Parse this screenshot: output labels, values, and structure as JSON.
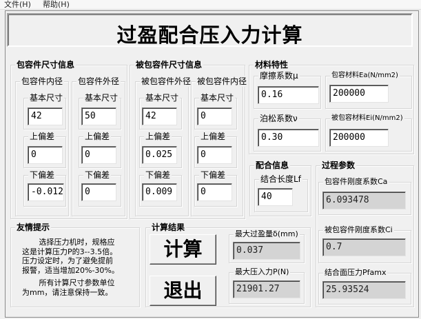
{
  "menu": {
    "file": "文件(H)",
    "help": "帮助(H)"
  },
  "title": "过盈配合压入力计算",
  "container": {
    "label": "包容件尺寸信息",
    "inner": {
      "label": "包容件内径",
      "basic": {
        "label": "基本尺寸",
        "value": "42"
      },
      "upper": {
        "label": "上偏差",
        "value": "0"
      },
      "lower": {
        "label": "下偏差",
        "value": "-0.012"
      }
    },
    "outer": {
      "label": "包容件外径",
      "basic": {
        "label": "基本尺寸",
        "value": "50"
      },
      "upper": {
        "label": "上偏差",
        "value": "0"
      },
      "lower": {
        "label": "下偏差",
        "value": "0"
      }
    }
  },
  "contained": {
    "label": "被包容件尺寸信息",
    "outer": {
      "label": "被包容件外径",
      "basic": {
        "label": "基本尺寸",
        "value": "42"
      },
      "upper": {
        "label": "上偏差",
        "value": "0.025"
      },
      "lower": {
        "label": "下偏差",
        "value": "0.009"
      }
    },
    "inner": {
      "label": "被包容件内径",
      "basic": {
        "label": "基本尺寸",
        "value": "0"
      },
      "upper": {
        "label": "上偏差",
        "value": "0"
      },
      "lower": {
        "label": "下偏差",
        "value": "0"
      }
    }
  },
  "material": {
    "label": "材料特性",
    "friction": {
      "label": "摩擦系数μ",
      "value": "0.16"
    },
    "ea": {
      "label": "包容材料Ea(N/mm2)",
      "value": "200000"
    },
    "poisson": {
      "label": "泊松系数ν",
      "value": "0.30"
    },
    "ei": {
      "label": "被包容材料Ei(N/mm2)",
      "value": "200000"
    }
  },
  "fit": {
    "label": "配合信息",
    "length": {
      "label": "结合长度Lf",
      "value": "40"
    }
  },
  "process": {
    "label": "过程参数",
    "ca": {
      "label": "包容件刚度系数Ca",
      "value": "6.093478"
    },
    "ci": {
      "label": "被包容件刚度系数Ci",
      "value": "0.7"
    },
    "pf": {
      "label": "结合面压力Pfamx",
      "value": "25.93524"
    }
  },
  "tips": {
    "label": "友情提示",
    "lines1": "       选择压力机时，规格应\n这是计算压力P的3--3.5倍。\n压力设定时，为了避免提前\n报警，适当增加20%-30%。",
    "lines2": "       所有计算尺寸参数单位\n为mm，请注意保持一致。"
  },
  "result": {
    "label": "计算结果",
    "calc_button": "计算",
    "exit_button": "退出",
    "max_interference": {
      "label": "最大过盈量δ(mm)",
      "value": "0.037"
    },
    "max_force": {
      "label": "最大压入力P(N)",
      "value": "21901.27"
    }
  }
}
